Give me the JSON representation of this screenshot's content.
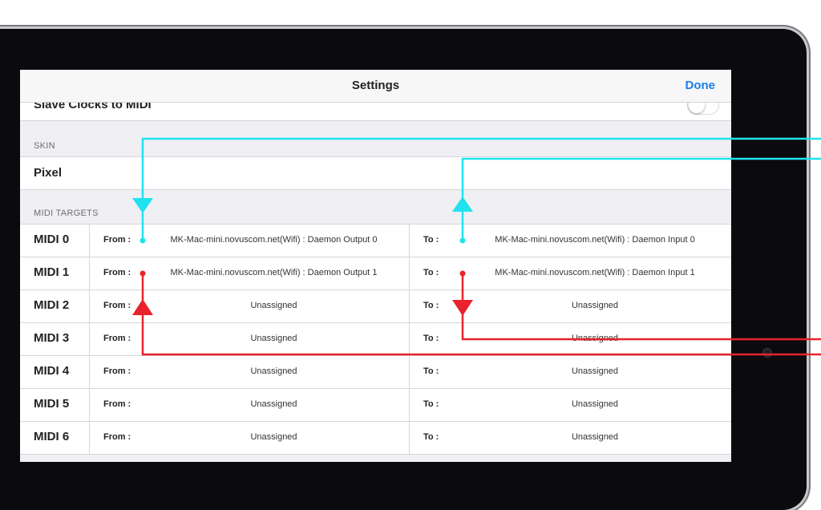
{
  "navbar": {
    "title": "Settings",
    "done_label": "Done"
  },
  "general": {
    "slave_clocks_label": "Slave Clocks to MIDI",
    "slave_clocks_on": false
  },
  "skin": {
    "header": "SKIN",
    "value": "Pixel"
  },
  "midi": {
    "header": "MIDI TARGETS",
    "from_label": "From :",
    "to_label": "To :",
    "rows": [
      {
        "name": "MIDI 0",
        "from": "MK-Mac-mini.novuscom.net(Wifi) : Daemon Output 0",
        "to": "MK-Mac-mini.novuscom.net(Wifi) : Daemon Input 0"
      },
      {
        "name": "MIDI 1",
        "from": "MK-Mac-mini.novuscom.net(Wifi) : Daemon Output 1",
        "to": "MK-Mac-mini.novuscom.net(Wifi) : Daemon Input 1"
      },
      {
        "name": "MIDI 2",
        "from": "Unassigned",
        "to": "Unassigned"
      },
      {
        "name": "MIDI 3",
        "from": "Unassigned",
        "to": "Unassigned"
      },
      {
        "name": "MIDI 4",
        "from": "Unassigned",
        "to": "Unassigned"
      },
      {
        "name": "MIDI 5",
        "from": "Unassigned",
        "to": "Unassigned"
      },
      {
        "name": "MIDI 6",
        "from": "Unassigned",
        "to": "Unassigned"
      }
    ]
  },
  "annotation_colors": {
    "cyan": "#1fe3ee",
    "red": "#e8232b"
  }
}
